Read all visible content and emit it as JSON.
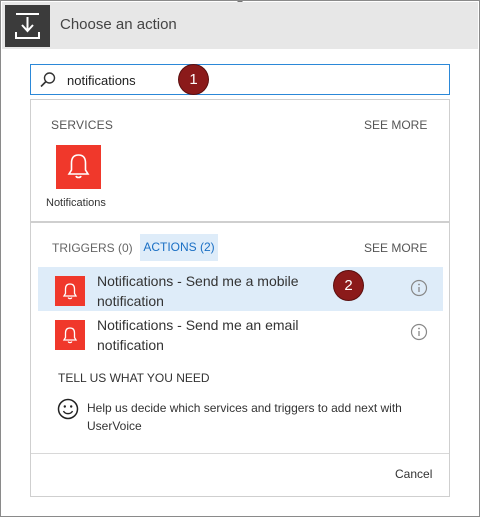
{
  "header": {
    "title": "Choose an action",
    "icon": "download-tray-icon"
  },
  "search": {
    "value": "notifications",
    "icon": "search-icon"
  },
  "callouts": [
    "1",
    "2"
  ],
  "services": {
    "label": "SERVICES",
    "see_more": "SEE MORE",
    "items": [
      {
        "name": "Notifications",
        "icon": "bell-icon",
        "color": "#f0382b"
      }
    ]
  },
  "tabs": {
    "triggers": "TRIGGERS (0)",
    "actions": "ACTIONS (2)",
    "see_more": "SEE MORE",
    "active": "actions"
  },
  "actions": [
    {
      "label": "Notifications - Send me a mobile notification",
      "icon": "bell-icon",
      "selected": true
    },
    {
      "label": "Notifications - Send me an email notification",
      "icon": "bell-icon",
      "selected": false
    }
  ],
  "feedback": {
    "heading": "TELL US WHAT YOU NEED",
    "text": "Help us decide which services and triggers to add next with UserVoice",
    "icon": "smiley-icon"
  },
  "footer": {
    "cancel": "Cancel"
  },
  "colors": {
    "accent": "#2b88d8",
    "service_red": "#f0382b",
    "selected_bg": "#deecf9",
    "callout": "#8b1a1a"
  }
}
